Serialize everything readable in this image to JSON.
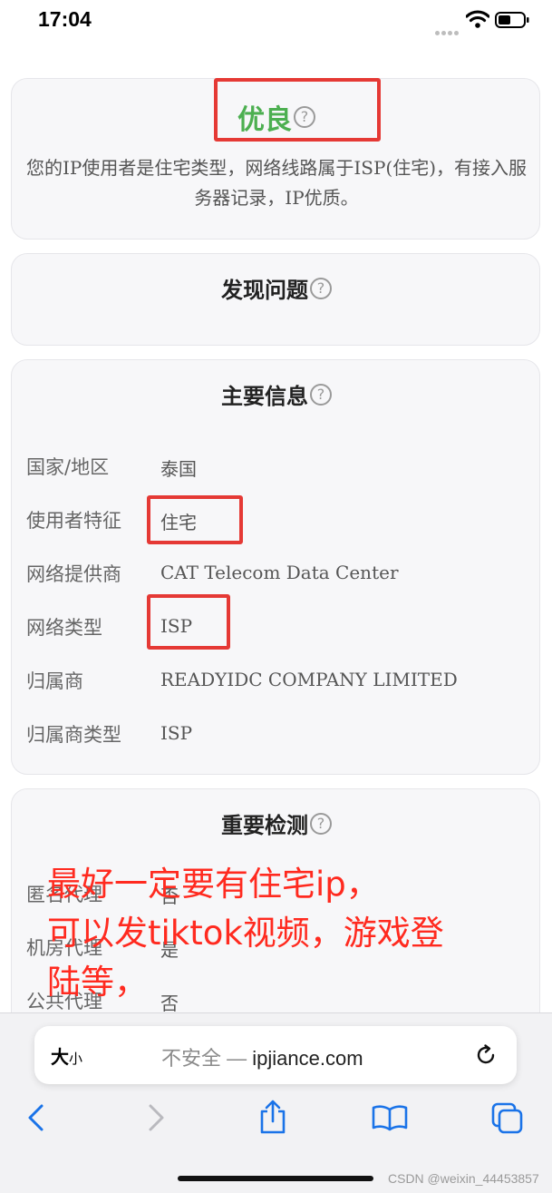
{
  "status_bar": {
    "time": "17:04"
  },
  "rating": {
    "label": "优良",
    "description": "您的IP使用者是住宅类型，网络线路属于ISP(住宅)，有接入服务器记录，IP优质。",
    "color": "#4caf50"
  },
  "sections": {
    "issues_title": "发现问题",
    "main_info_title": "主要信息",
    "checks_title": "重要检测"
  },
  "main_info": [
    {
      "key": "国家/地区",
      "value": "泰国"
    },
    {
      "key": "使用者特征",
      "value": "住宅"
    },
    {
      "key": "网络提供商",
      "value": "CAT Telecom Data Center"
    },
    {
      "key": "网络类型",
      "value": "ISP"
    },
    {
      "key": "归属商",
      "value": "READYIDC COMPANY LIMITED"
    },
    {
      "key": "归属商类型",
      "value": "ISP"
    }
  ],
  "checks": [
    {
      "key": "匿名代理",
      "value": "否"
    },
    {
      "key": "机房代理",
      "value": "是"
    },
    {
      "key": "公共代理",
      "value": "否"
    }
  ],
  "annotation": {
    "line1": "最好一定要有住宅ip，",
    "line2": "可以发tiktok视频，游戏登",
    "line3": "陆等，",
    "color": "#ff2a1f"
  },
  "browser": {
    "text_size_label": "大",
    "text_size_small": "小",
    "insecure_label": "不安全 —",
    "domain": "ipjiance.com"
  },
  "watermark": "CSDN @weixin_44453857",
  "help_glyph": "?"
}
